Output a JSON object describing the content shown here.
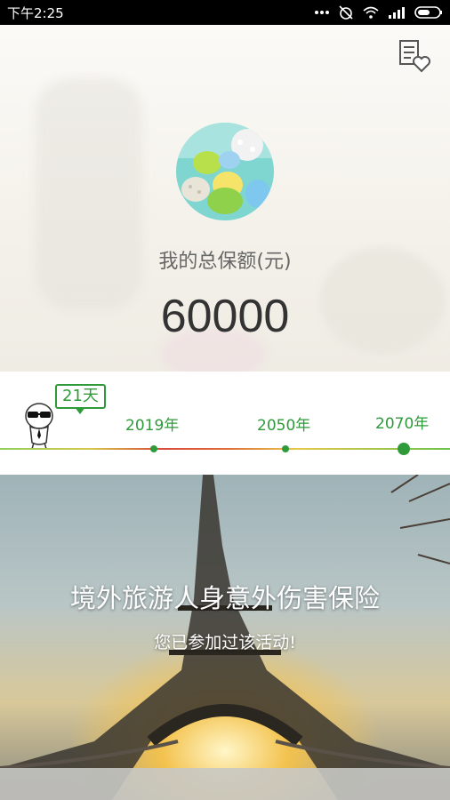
{
  "status_bar": {
    "time": "下午2:25"
  },
  "hero": {
    "total_label": "我的总保额(元)",
    "total_value": "60000"
  },
  "timeline": {
    "days_badge": "21天",
    "years": [
      "2019年",
      "2050年",
      "2070年"
    ],
    "accent_color": "#2f9a3a"
  },
  "activity": {
    "title": "境外旅游人身意外伤害保险",
    "subtitle": "您已参加过该活动!"
  }
}
